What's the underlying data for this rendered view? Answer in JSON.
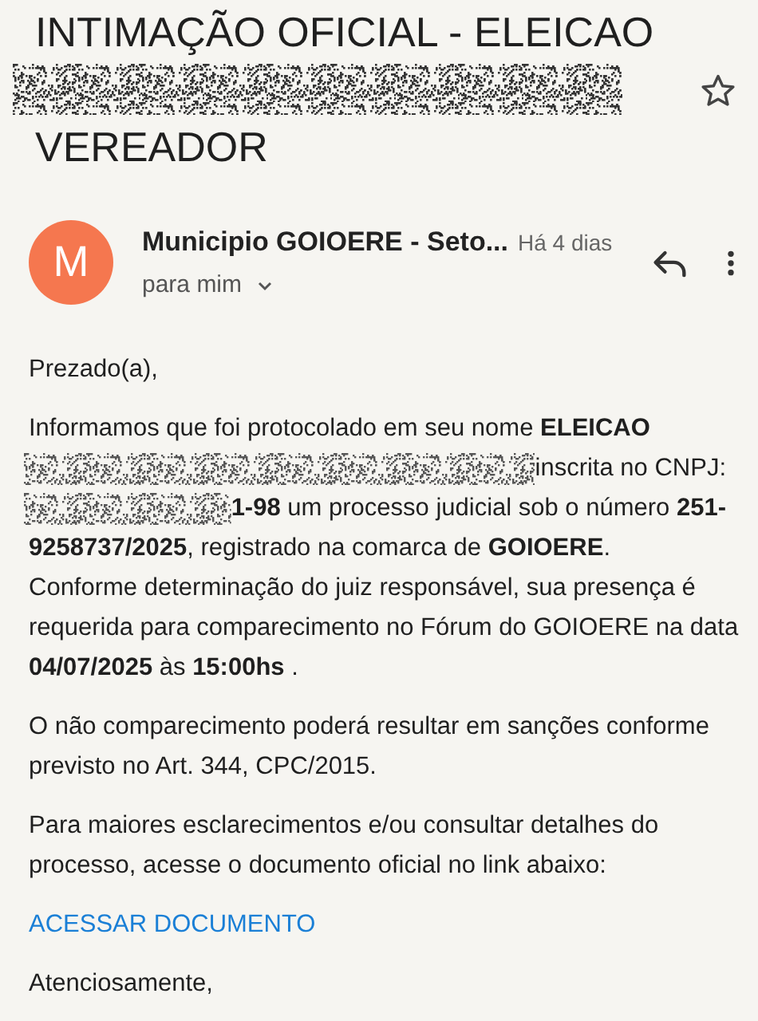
{
  "subject": {
    "lines": [
      {
        "text": "INTIMAÇÃO OFICIAL - ELEICAO"
      },
      {
        "redacted": true
      },
      {
        "text": "VEREADOR"
      }
    ],
    "starred": false
  },
  "message": {
    "avatar_letter": "M",
    "sender": "Municipio GOIOERE - Seto...",
    "time": "Há 4 dias",
    "recipient": "para mim"
  },
  "body": {
    "greeting": "Prezado(a),",
    "paragraph_lines": [
      {
        "text": "Informamos que foi protocolado em seu nome **ELEICAO**"
      },
      {
        "redacted": true,
        "text": "inscrita no CNPJ:"
      },
      {
        "redacted": true,
        "text": "**1-98** um processo judicial sob o número **251-**"
      },
      {
        "text": "**9258737/2025**, registrado na comarca de **GOIOERE**."
      },
      {
        "text": "Conforme determinação do juiz responsável, sua presença é"
      },
      {
        "text": "requerida para comparecimento no Fórum do GOIOERE na data"
      },
      {
        "text": "**04/07/2025** às **15:00hs** ."
      }
    ],
    "paragraphs": [
      "O não comparecimento poderá resultar em sanções conforme previsto no Art. 344, CPC/2015.",
      "Para maiores esclarecimentos e/ou consultar detalhes do processo, acesse o documento oficial no link abaixo:"
    ],
    "link": "ACESSAR DOCUMENTO",
    "closing": "Atenciosamente,"
  }
}
